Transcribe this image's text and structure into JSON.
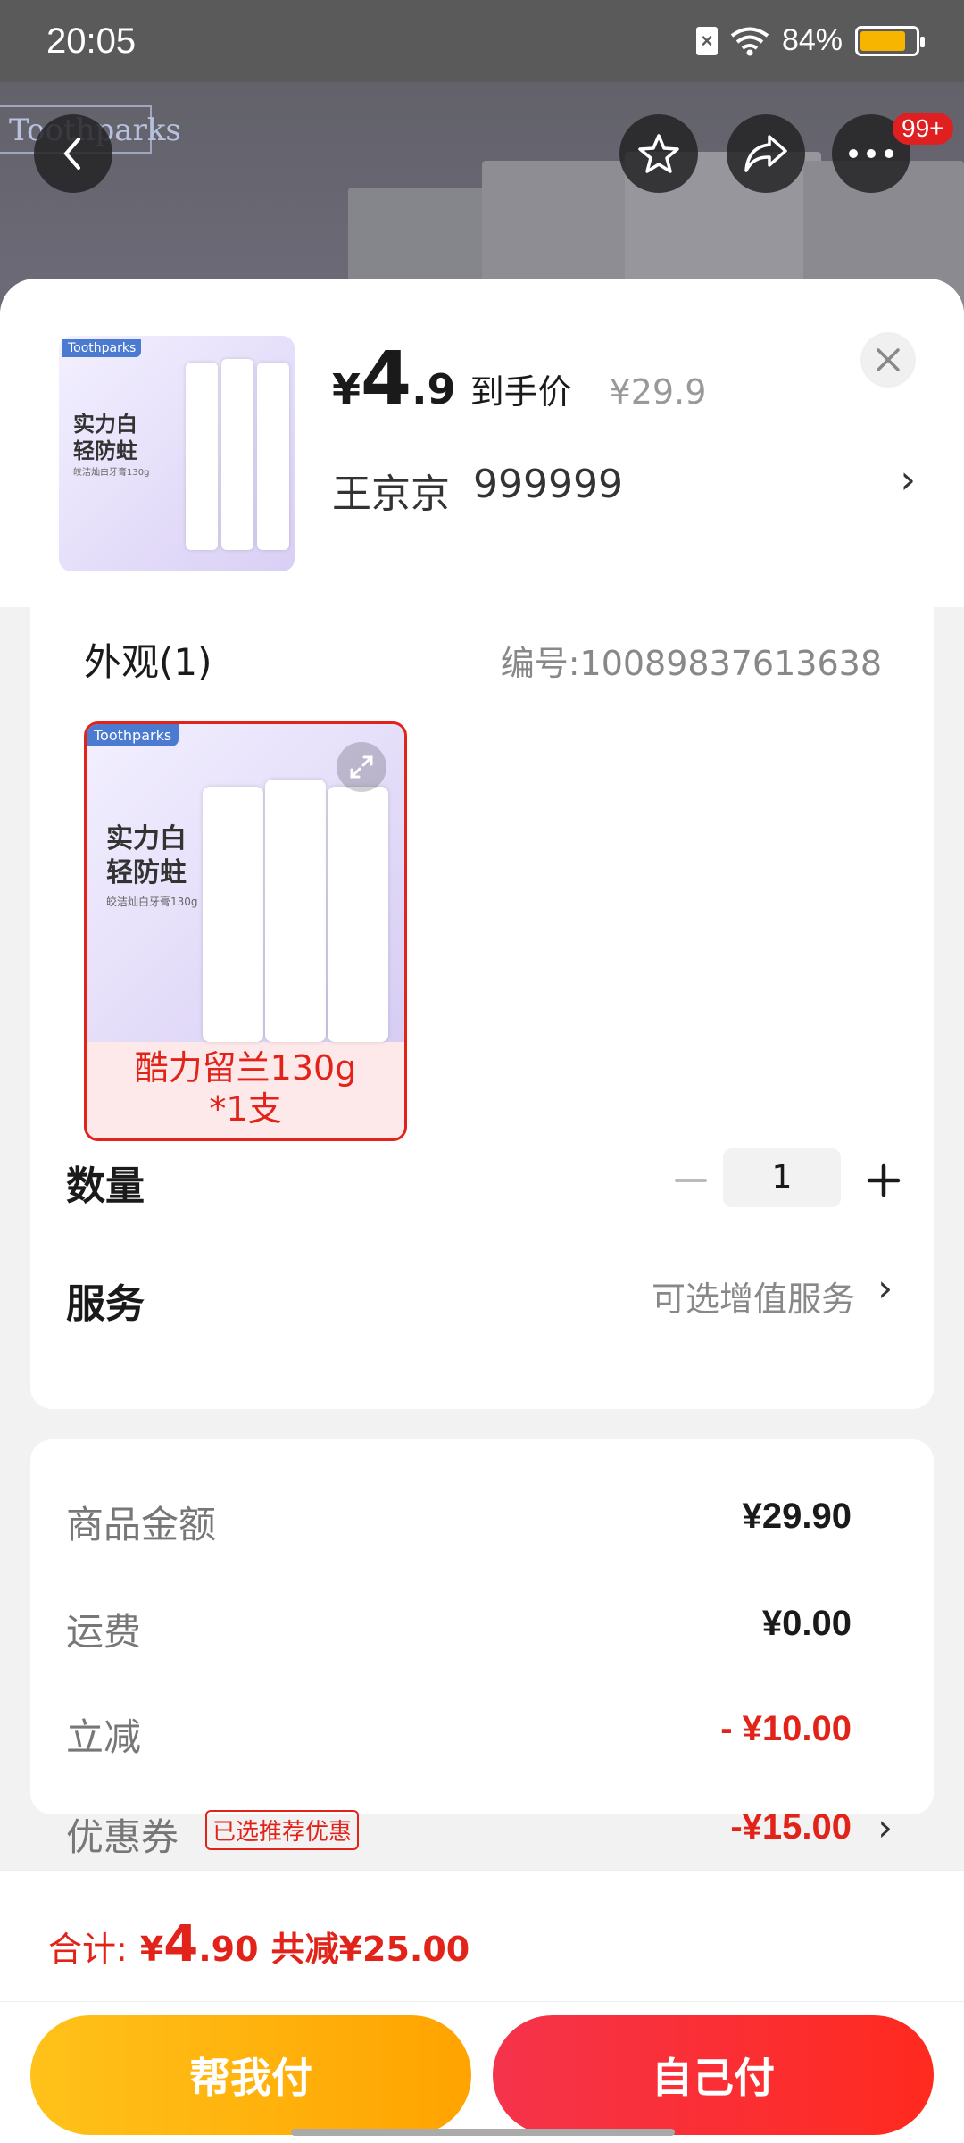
{
  "status_bar": {
    "time": "20:05",
    "battery": "84%",
    "battery_level": 0.84
  },
  "nav": {
    "badge": "99+"
  },
  "background": {
    "brand": "Toothparks"
  },
  "product": {
    "currency": "¥",
    "price_int": "4",
    "price_dec": ".9",
    "price_tag": "到手价",
    "original_price": "¥29.9",
    "shop_name": "王京京",
    "shop_id": "999999",
    "thumb_text_1": "实力白",
    "thumb_text_2": "轻防蛀",
    "thumb_text_3": "皎洁灿白牙膏130g"
  },
  "appearance": {
    "label": "外观(1)",
    "sku_no": "编号:10089837613638",
    "option_line1": "酷力留兰130g",
    "option_line2": "*1支"
  },
  "quantity": {
    "label": "数量",
    "value": "1"
  },
  "service": {
    "label": "服务",
    "value": "可选增值服务"
  },
  "fees": {
    "goods_label": "商品金额",
    "goods_value": "¥29.90",
    "shipping_label": "运费",
    "shipping_value": "¥0.00",
    "discount_label": "立减",
    "discount_value": "- ¥10.00",
    "coupon_label": "优惠券",
    "coupon_tag": "已选推荐优惠",
    "coupon_value": "-¥15.00"
  },
  "summary": {
    "total_label": "合计:",
    "currency": "¥",
    "total_int": "4",
    "total_dec": ".90",
    "saved": "共减¥25.00"
  },
  "buttons": {
    "help_pay": "帮我付",
    "self_pay": "自己付"
  },
  "colors": {
    "accent_red": "#e2231a",
    "help_button": "#ffb300",
    "self_button": "#f5334b",
    "battery_fill": "#f7b500"
  }
}
